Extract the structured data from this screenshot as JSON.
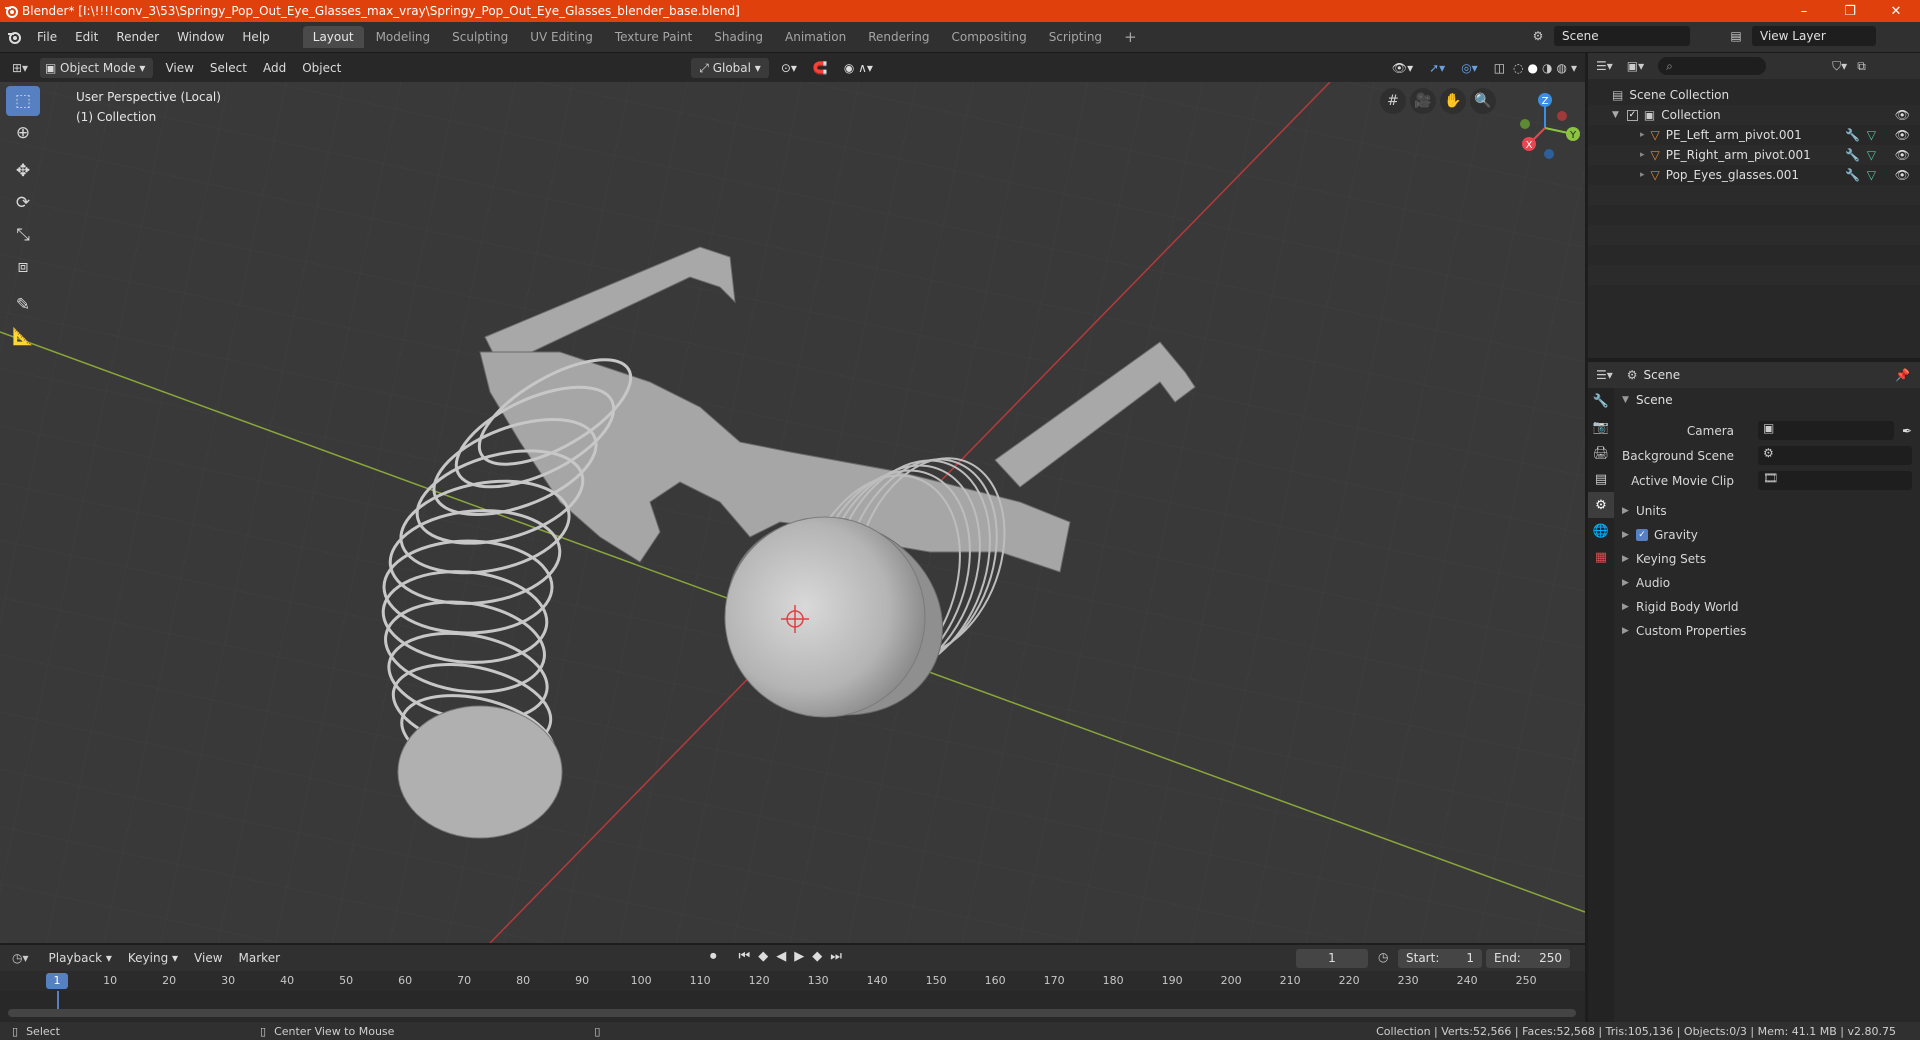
{
  "window": {
    "title": "Blender* [I:\\!!!!conv_3\\53\\Springy_Pop_Out_Eye_Glasses_max_vray\\Springy_Pop_Out_Eye_Glasses_blender_base.blend]",
    "controls": {
      "minimize": "–",
      "restore": "❐",
      "close": "✕"
    }
  },
  "menubar": {
    "items": [
      "File",
      "Edit",
      "Render",
      "Window",
      "Help"
    ]
  },
  "workspaces": {
    "tabs": [
      "Layout",
      "Modeling",
      "Sculpting",
      "UV Editing",
      "Texture Paint",
      "Shading",
      "Animation",
      "Rendering",
      "Compositing",
      "Scripting"
    ],
    "active": "Layout",
    "add": "+"
  },
  "scene_selector": {
    "value": "Scene"
  },
  "viewlayer_selector": {
    "value": "View Layer"
  },
  "viewport_header": {
    "mode": "Object Mode",
    "menus": [
      "View",
      "Select",
      "Add",
      "Object"
    ],
    "orientation": "Global"
  },
  "viewport": {
    "perspective": "User Perspective (Local)",
    "collection": "(1) Collection",
    "gizmo_axes": {
      "x": "X",
      "y": "Y",
      "z": "Z"
    }
  },
  "outliner": {
    "root": "Scene Collection",
    "collection": "Collection",
    "objects": [
      "PE_Left_arm_pivot.001",
      "PE_Right_arm_pivot.001",
      "Pop_Eyes_glasses.001"
    ]
  },
  "properties": {
    "header": "Scene",
    "panel": "Scene",
    "fields": {
      "camera": "Camera",
      "background_scene": "Background Scene",
      "active_movie_clip": "Active Movie Clip"
    },
    "subpanels": [
      "Units",
      "Gravity",
      "Keying Sets",
      "Audio",
      "Rigid Body World",
      "Custom Properties"
    ],
    "gravity_checked": true
  },
  "timeline": {
    "menus": [
      "Playback",
      "Keying",
      "View",
      "Marker"
    ],
    "current_frame": "1",
    "start_label": "Start:",
    "start": "1",
    "end_label": "End:",
    "end": "250",
    "ruler": [
      "1",
      "10",
      "20",
      "30",
      "40",
      "50",
      "60",
      "70",
      "80",
      "90",
      "100",
      "110",
      "120",
      "130",
      "140",
      "150",
      "160",
      "170",
      "180",
      "190",
      "200",
      "210",
      "220",
      "230",
      "240",
      "250"
    ]
  },
  "statusbar": {
    "left": "Select",
    "middle": "Center View to Mouse",
    "right": "Collection | Verts:52,566 | Faces:52,568 | Tris:105,136 | Objects:0/3 | Mem: 41.1 MB | v2.80.75"
  },
  "colors": {
    "accent": "#e0410c",
    "active_tool": "#5680c2",
    "x_axis": "#e6464f",
    "y_axis": "#8bc53f",
    "z_axis": "#3a8ee6",
    "object_icon": "#e08c3c",
    "modifier_icon": "#5ea0e8",
    "mesh_icon": "#4fc79a"
  }
}
